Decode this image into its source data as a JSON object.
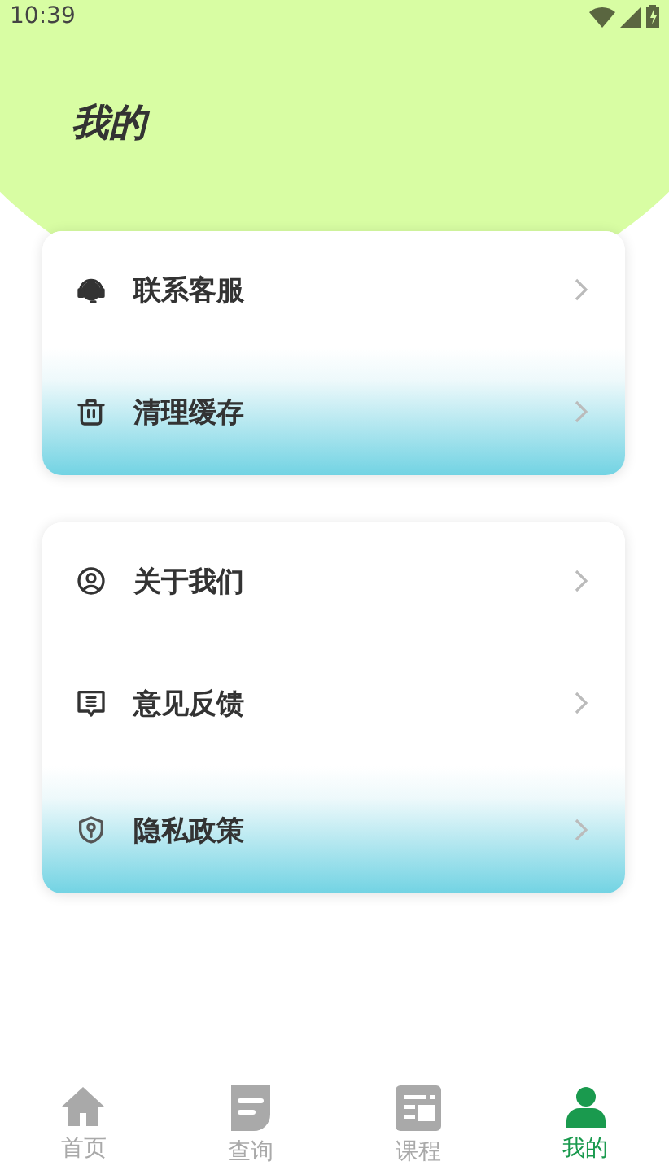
{
  "status_bar": {
    "time": "10:39"
  },
  "header": {
    "title": "我的"
  },
  "groups": [
    {
      "items": [
        {
          "kind": "headset",
          "label": "联系客服",
          "highlighted": false
        },
        {
          "kind": "trash",
          "label": "清理缓存",
          "highlighted": true
        }
      ]
    },
    {
      "items": [
        {
          "kind": "person",
          "label": "关于我们",
          "highlighted": false
        },
        {
          "kind": "feedback",
          "label": "意见反馈",
          "highlighted": false
        },
        {
          "kind": "shield",
          "label": "隐私政策",
          "highlighted": true
        }
      ]
    }
  ],
  "bottom_nav": [
    {
      "kind": "home",
      "label": "首页",
      "selected": false
    },
    {
      "kind": "query",
      "label": "查询",
      "selected": false
    },
    {
      "kind": "course",
      "label": "课程",
      "selected": false
    },
    {
      "kind": "me",
      "label": "我的",
      "selected": true
    }
  ]
}
